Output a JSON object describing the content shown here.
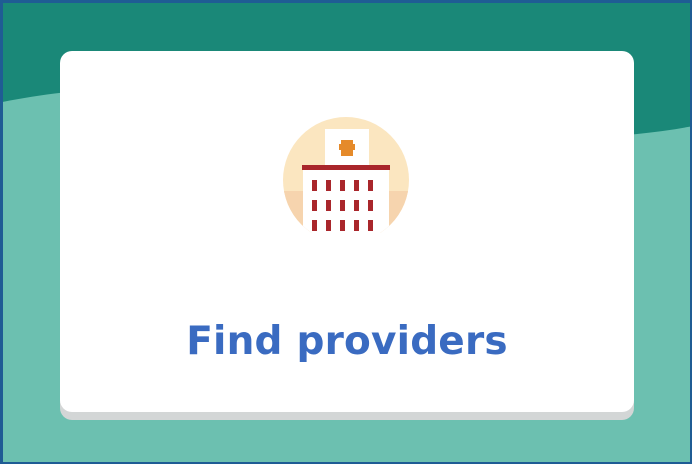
{
  "card": {
    "label": "Find providers",
    "icon": "hospital-icon"
  },
  "colors": {
    "background": "#1a8878",
    "background_wave": "#6cc0b0",
    "frame_border": "#1f5c94",
    "card_background": "#ffffff",
    "label": "#3a6bc1",
    "icon_circle": "#fbe6c0",
    "icon_cross": "#e58a2a",
    "icon_windows": "#a9262b"
  }
}
